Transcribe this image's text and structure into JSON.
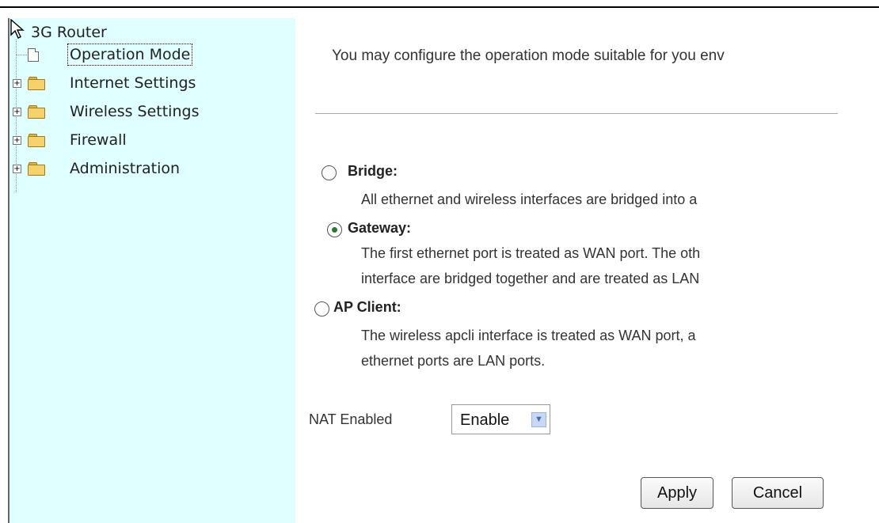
{
  "sidebar": {
    "root_label": "3G Router",
    "items": [
      {
        "label": "Operation Mode"
      },
      {
        "label": "Internet Settings"
      },
      {
        "label": "Wireless Settings"
      },
      {
        "label": "Firewall"
      },
      {
        "label": "Administration"
      }
    ]
  },
  "main": {
    "intro": "You may configure the operation mode suitable for you env",
    "modes": [
      {
        "label": "Bridge:",
        "selected": false,
        "desc": [
          "All ethernet and wireless interfaces are bridged into a"
        ]
      },
      {
        "label": "Gateway:",
        "selected": true,
        "desc": [
          "The first ethernet port is treated as WAN port. The oth",
          "interface are bridged together and are treated as LAN"
        ]
      },
      {
        "label": "AP Client:",
        "selected": false,
        "desc": [
          "The wireless apcli interface is treated as WAN port, a",
          "ethernet ports are LAN ports."
        ]
      }
    ],
    "nat_label": "NAT Enabled",
    "nat_value": "Enable",
    "apply_label": "Apply",
    "cancel_label": "Cancel"
  },
  "colors": {
    "sidebar_bg": "#e0ffff",
    "radio_selected": "#2a7a2a"
  }
}
